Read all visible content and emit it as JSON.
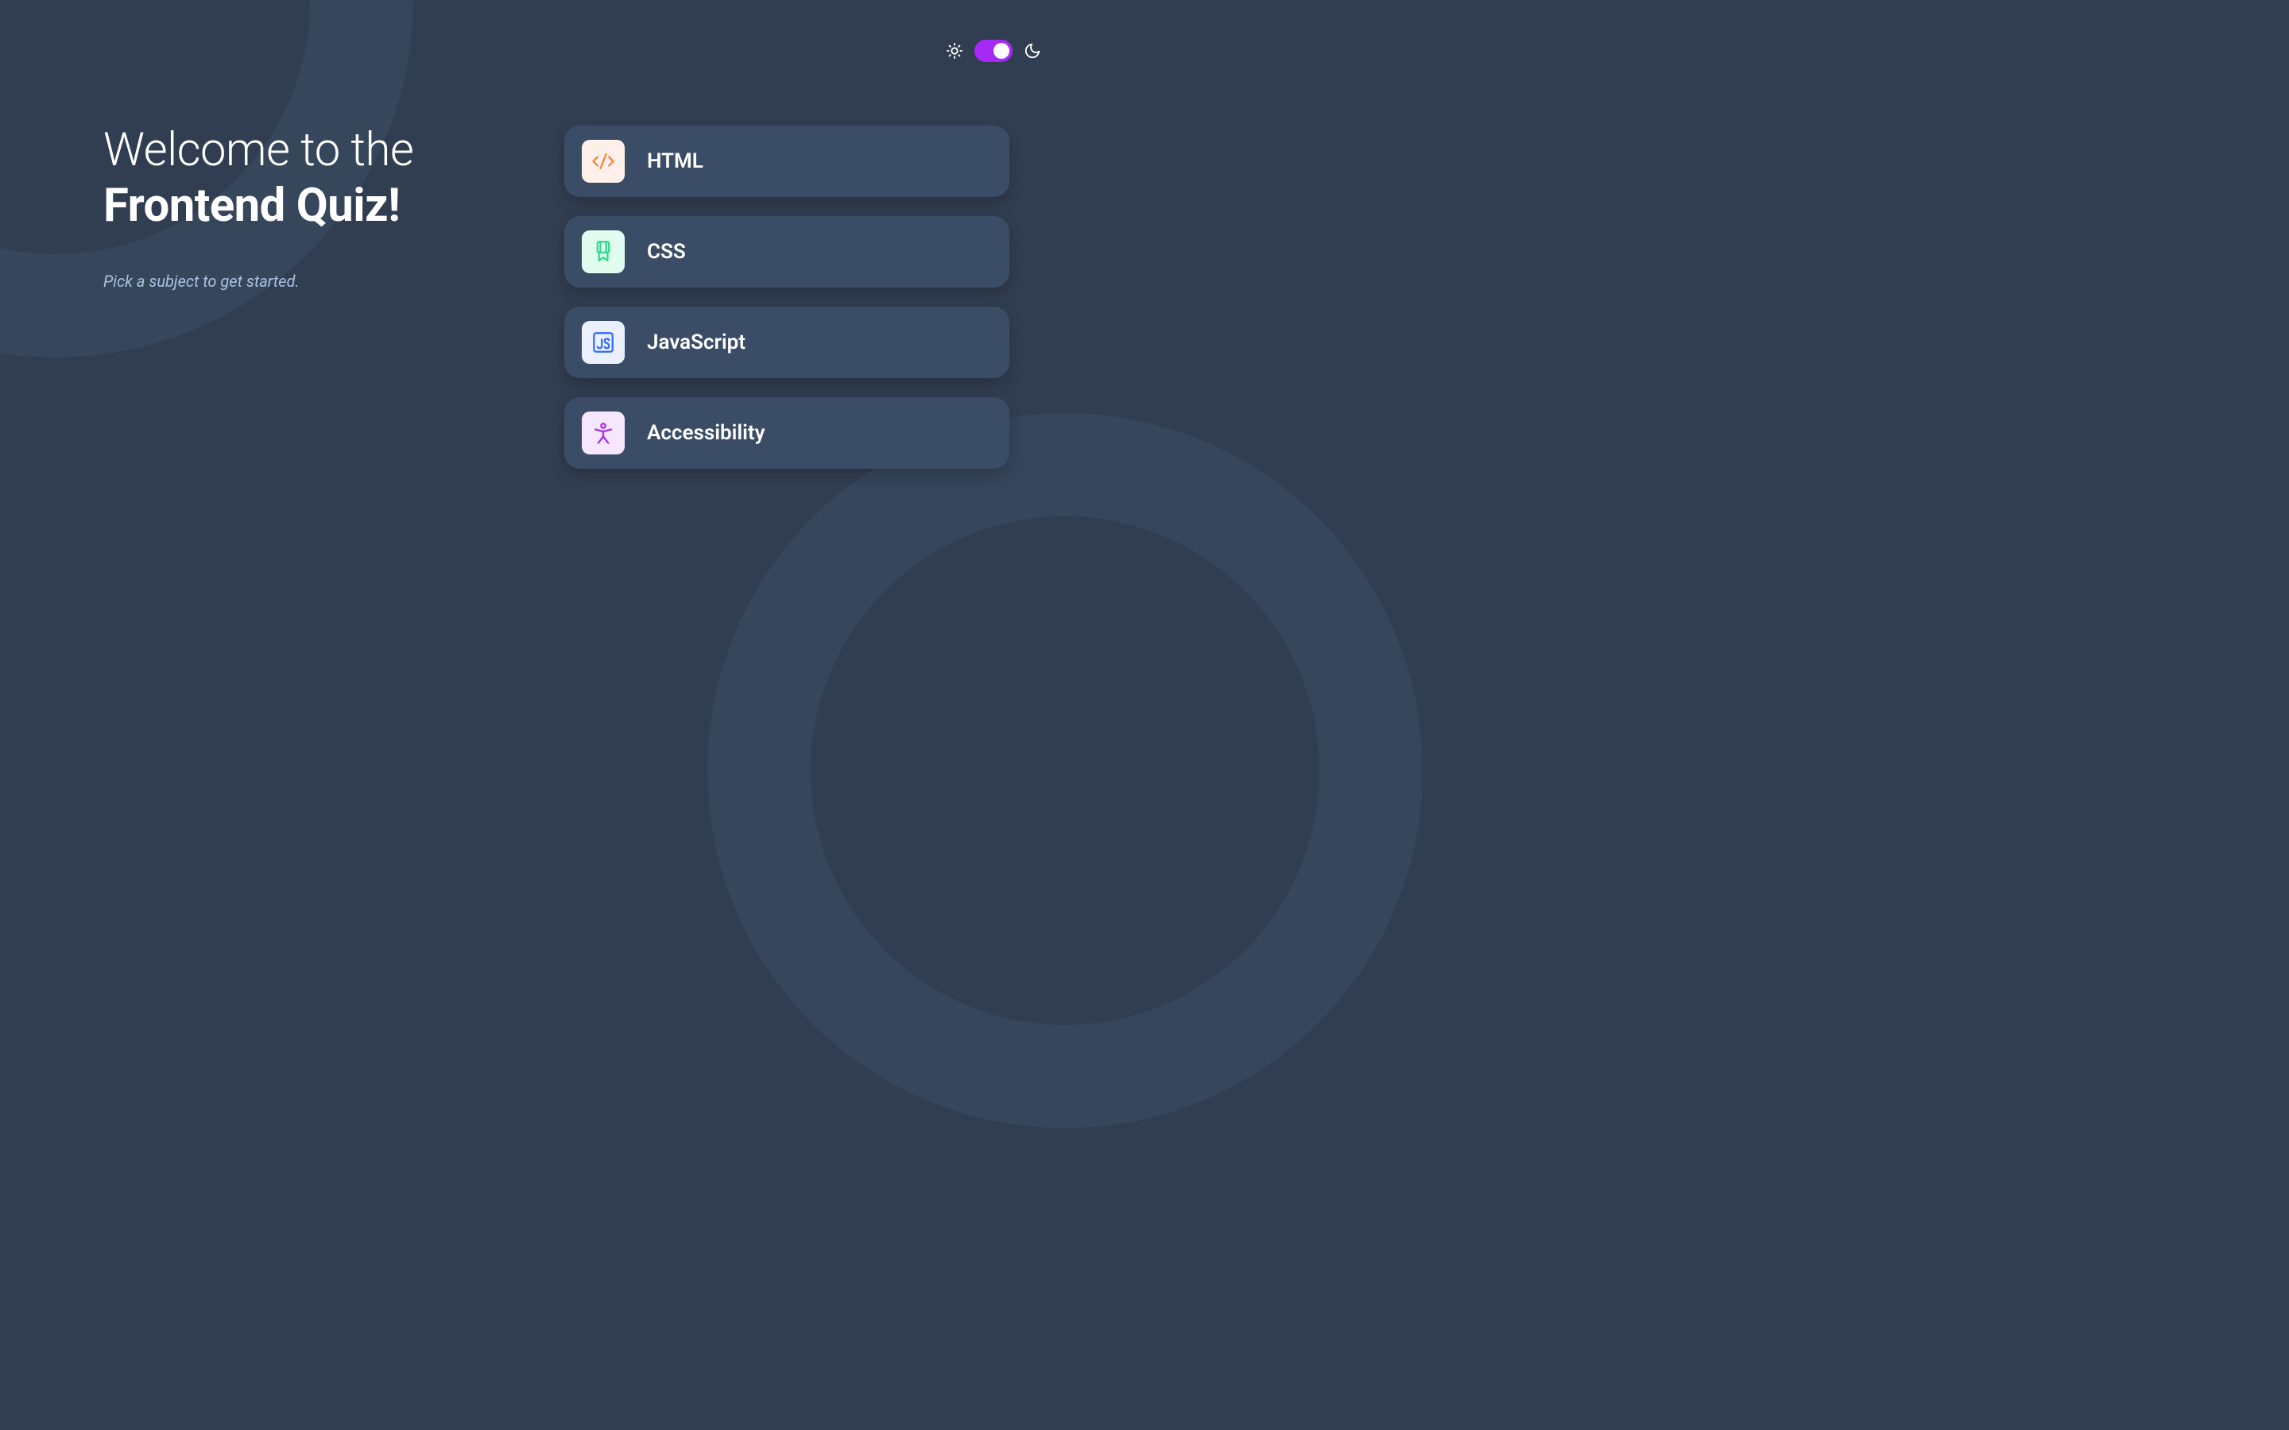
{
  "heading": {
    "line1": "Welcome to the",
    "line2": "Frontend Quiz!"
  },
  "subtitle": "Pick a subject to get started.",
  "subjects": {
    "0": {
      "label": "HTML"
    },
    "1": {
      "label": "CSS"
    },
    "2": {
      "label": "JavaScript"
    },
    "3": {
      "label": "Accessibility"
    }
  },
  "theme": {
    "mode": "dark",
    "accent": "#A729F5"
  }
}
